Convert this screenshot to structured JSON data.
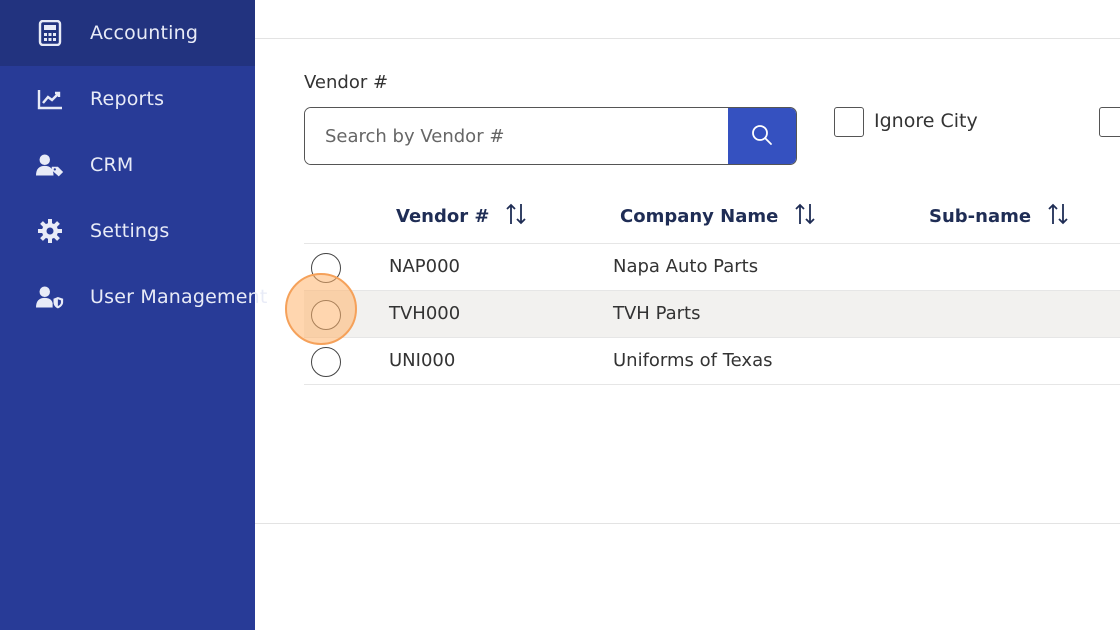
{
  "sidebar": {
    "items": [
      {
        "label": "Accounting",
        "icon": "calculator-icon",
        "active": true
      },
      {
        "label": "Reports",
        "icon": "line-chart-icon",
        "active": false
      },
      {
        "label": "CRM",
        "icon": "user-tag-icon",
        "active": false
      },
      {
        "label": "Settings",
        "icon": "gear-icon",
        "active": false
      },
      {
        "label": "User Management",
        "icon": "user-shield-icon",
        "active": false
      }
    ]
  },
  "search": {
    "label": "Vendor #",
    "placeholder": "Search by Vendor #",
    "value": ""
  },
  "filters": {
    "ignore_city_label": "Ignore City",
    "ignore_city_checked": false
  },
  "table": {
    "columns": [
      "Vendor #",
      "Company Name",
      "Sub-name"
    ],
    "rows": [
      {
        "vendor": "NAP000",
        "company": "Napa Auto Parts",
        "subname": ""
      },
      {
        "vendor": "TVH000",
        "company": "TVH Parts",
        "subname": ""
      },
      {
        "vendor": "UNI000",
        "company": "Uniforms of Texas",
        "subname": ""
      }
    ]
  },
  "colors": {
    "sidebar_bg": "#283b97",
    "sidebar_active": "#22337f",
    "accent": "#3551c0",
    "click_marker": "#f5a15a"
  }
}
